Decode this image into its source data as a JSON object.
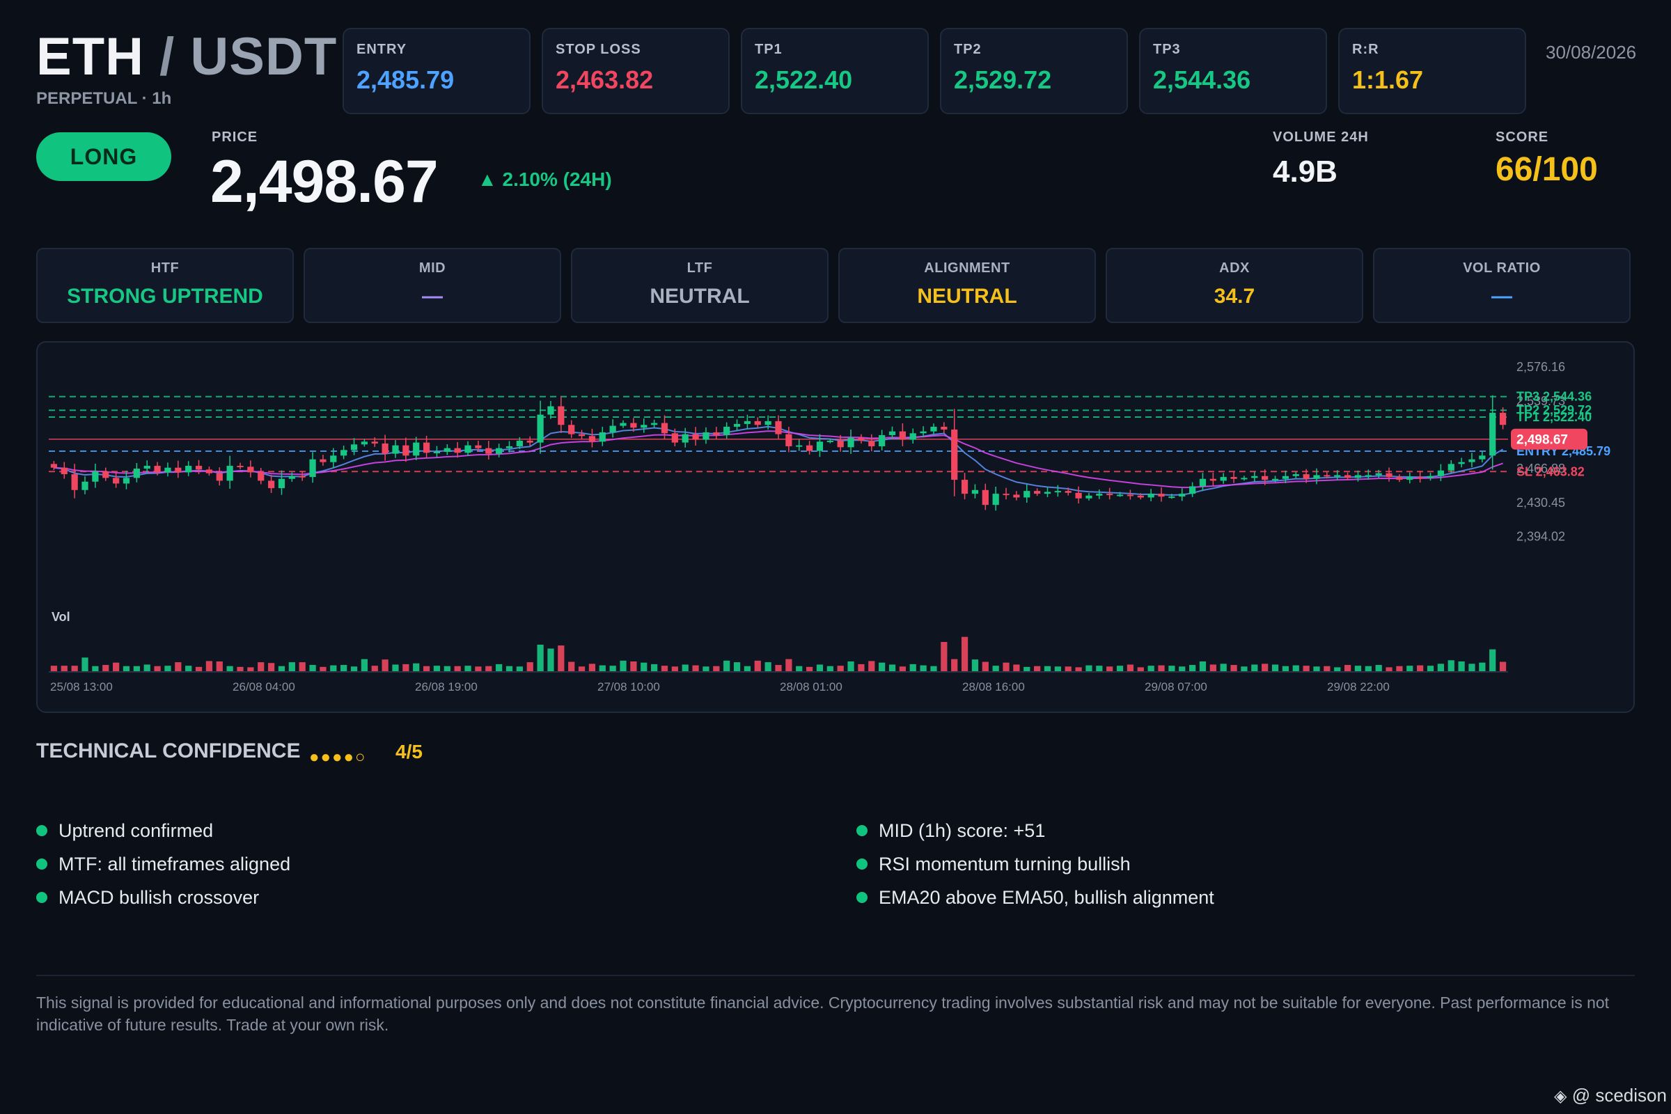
{
  "header": {
    "base": "ETH",
    "separator": "/",
    "quote": "USDT",
    "subtitle": "PERPETUAL · 1h",
    "date": "30/08/2026"
  },
  "levels": [
    {
      "label": "ENTRY",
      "value": "2,485.79",
      "color": "#4da3ff"
    },
    {
      "label": "STOP LOSS",
      "value": "2,463.82",
      "color": "#f0465f"
    },
    {
      "label": "TP1",
      "value": "2,522.40",
      "color": "#17c784"
    },
    {
      "label": "TP2",
      "value": "2,529.72",
      "color": "#17c784"
    },
    {
      "label": "TP3",
      "value": "2,544.36",
      "color": "#17c784"
    },
    {
      "label": "R:R",
      "value": "1:1.67",
      "color": "#f5c01a"
    }
  ],
  "signal": {
    "direction": "LONG"
  },
  "price": {
    "label": "PRICE",
    "value": "2,498.67",
    "change": "▲ 2.10% (24H)"
  },
  "volume": {
    "label": "VOLUME 24H",
    "value": "4.9B"
  },
  "score": {
    "label": "SCORE",
    "value": "66/100"
  },
  "trend_cards": [
    {
      "label": "HTF",
      "value": "STRONG UPTREND",
      "color": "#17c784"
    },
    {
      "label": "MID",
      "value": "—",
      "color": "#a78bfa"
    },
    {
      "label": "LTF",
      "value": "NEUTRAL",
      "color": "#aab2bf"
    },
    {
      "label": "ALIGNMENT",
      "value": "NEUTRAL",
      "color": "#f5c01a"
    },
    {
      "label": "ADX",
      "value": "34.7",
      "color": "#f5c01a"
    },
    {
      "label": "VOL RATIO",
      "value": "—",
      "color": "#4da3ff"
    }
  ],
  "chart_data": {
    "type": "candlestick",
    "ylim": [
      2378,
      2592
    ],
    "yticks": [
      "2,576.16",
      "2,539.73",
      "2,503.30",
      "2,466.88",
      "2,430.45",
      "2,394.02"
    ],
    "yticks_values": [
      2576.16,
      2539.73,
      2503.3,
      2466.88,
      2430.45,
      2394.02
    ],
    "xticks": [
      "25/08 13:00",
      "26/08 04:00",
      "26/08 19:00",
      "27/08 10:00",
      "28/08 01:00",
      "28/08 16:00",
      "29/08 07:00",
      "29/08 22:00"
    ],
    "volume_label": "Vol",
    "lines": [
      {
        "name": "TP3 2,544.36",
        "value": 2544.36,
        "color": "#17c784"
      },
      {
        "name": "TP2 2,529.72",
        "value": 2529.72,
        "color": "#17c784"
      },
      {
        "name": "TP1 2,522.40",
        "value": 2522.4,
        "color": "#17c784"
      },
      {
        "name": "ENTRY 2,485.79",
        "value": 2485.79,
        "color": "#4da3ff"
      },
      {
        "name": "SL 2,463.82",
        "value": 2463.82,
        "color": "#f0465f"
      }
    ],
    "last_price": {
      "label": "2,498.67",
      "value": 2498.67
    },
    "closes": [
      2468,
      2461,
      2444,
      2453,
      2464,
      2457,
      2451,
      2457,
      2467,
      2470,
      2463,
      2468,
      2463,
      2470,
      2466,
      2462,
      2454,
      2470,
      2469,
      2463,
      2454,
      2446,
      2456,
      2459,
      2458,
      2477,
      2474,
      2481,
      2487,
      2493,
      2496,
      2494,
      2483,
      2492,
      2481,
      2495,
      2484,
      2485,
      2489,
      2484,
      2492,
      2489,
      2483,
      2489,
      2491,
      2497,
      2495,
      2525,
      2534,
      2514,
      2504,
      2502,
      2496,
      2506,
      2513,
      2516,
      2511,
      2514,
      2516,
      2505,
      2495,
      2504,
      2498,
      2506,
      2503,
      2512,
      2515,
      2518,
      2514,
      2518,
      2504,
      2491,
      2492,
      2486,
      2496,
      2497,
      2490,
      2500,
      2497,
      2491,
      2503,
      2507,
      2498,
      2505,
      2507,
      2512,
      2509,
      2455,
      2440,
      2444,
      2428,
      2440,
      2439,
      2436,
      2443,
      2440,
      2442,
      2443,
      2441,
      2435,
      2438,
      2440,
      2439,
      2439,
      2438,
      2436,
      2440,
      2437,
      2437,
      2440,
      2448,
      2456,
      2454,
      2458,
      2456,
      2457,
      2459,
      2455,
      2456,
      2459,
      2461,
      2456,
      2460,
      2459,
      2460,
      2457,
      2460,
      2460,
      2462,
      2458,
      2455,
      2458,
      2457,
      2459,
      2465,
      2472,
      2474,
      2477,
      2481,
      2527,
      2514
    ],
    "volume_scale": [
      0.14,
      0.14,
      0.14,
      0.35,
      0.13,
      0.16,
      0.22,
      0.13,
      0.13,
      0.17,
      0.13,
      0.14,
      0.23,
      0.14,
      0.11,
      0.26,
      0.25,
      0.13,
      0.11,
      0.1,
      0.23,
      0.21,
      0.13,
      0.23,
      0.23,
      0.16,
      0.11,
      0.15,
      0.16,
      0.12,
      0.31,
      0.14,
      0.3,
      0.17,
      0.18,
      0.2,
      0.13,
      0.14,
      0.13,
      0.13,
      0.14,
      0.12,
      0.13,
      0.18,
      0.13,
      0.12,
      0.23,
      0.68,
      0.58,
      0.66,
      0.24,
      0.12,
      0.19,
      0.15,
      0.14,
      0.27,
      0.25,
      0.22,
      0.18,
      0.14,
      0.12,
      0.17,
      0.15,
      0.12,
      0.13,
      0.27,
      0.23,
      0.13,
      0.27,
      0.23,
      0.16,
      0.31,
      0.13,
      0.11,
      0.17,
      0.13,
      0.14,
      0.25,
      0.18,
      0.26,
      0.22,
      0.17,
      0.12,
      0.18,
      0.15,
      0.13,
      0.75,
      0.31,
      0.88,
      0.3,
      0.24,
      0.14,
      0.22,
      0.17,
      0.11,
      0.13,
      0.13,
      0.12,
      0.12,
      0.1,
      0.15,
      0.14,
      0.12,
      0.14,
      0.17,
      0.1,
      0.14,
      0.15,
      0.14,
      0.12,
      0.16,
      0.25,
      0.17,
      0.19,
      0.16,
      0.12,
      0.17,
      0.19,
      0.17,
      0.13,
      0.15,
      0.14,
      0.12,
      0.13,
      0.1,
      0.16,
      0.14,
      0.13,
      0.16,
      0.1,
      0.13,
      0.14,
      0.15,
      0.14,
      0.19,
      0.28,
      0.25,
      0.19,
      0.22,
      0.56,
      0.24
    ],
    "ema_fast_color": "#5b8def",
    "ema_slow_color": "#d946ef"
  },
  "confidence": {
    "title": "TECHNICAL CONFIDENCE",
    "dots": "●●●●○",
    "value": "4/5"
  },
  "reasons_left": [
    "Uptrend confirmed",
    "MTF: all timeframes aligned",
    "MACD bullish crossover"
  ],
  "reasons_right": [
    "MID (1h) score: +51",
    "RSI momentum turning bullish",
    "EMA20 above EMA50, bullish alignment"
  ],
  "disclaimer": "This signal is provided for educational and informational purposes only and does not constitute financial advice. Cryptocurrency trading involves substantial risk and may not be suitable for everyone. Past performance is not indicative of future results. Trade at your own risk.",
  "watermark": "@ scedison"
}
